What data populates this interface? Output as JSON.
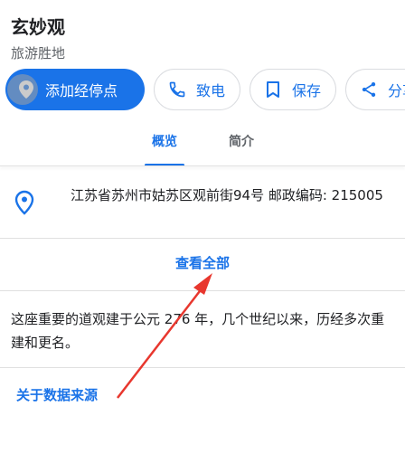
{
  "place": {
    "name": "玄妙观",
    "category": "旅游胜地"
  },
  "actions": {
    "add_stop": "添加经停点",
    "call": "致电",
    "save": "保存",
    "share": "分享"
  },
  "tabs": [
    {
      "label": "概览",
      "active": true
    },
    {
      "label": "简介",
      "active": false
    }
  ],
  "address": {
    "text": "江苏省苏州市姑苏区观前街94号 邮政编码: 215005"
  },
  "view_all": "查看全部",
  "description": "这座重要的道观建于公元 276 年，几个世纪以来，历经多次重建和更名。",
  "data_source_link": "关于数据来源",
  "colors": {
    "accent": "#1a73e8",
    "annotation_arrow": "#e8372e"
  }
}
